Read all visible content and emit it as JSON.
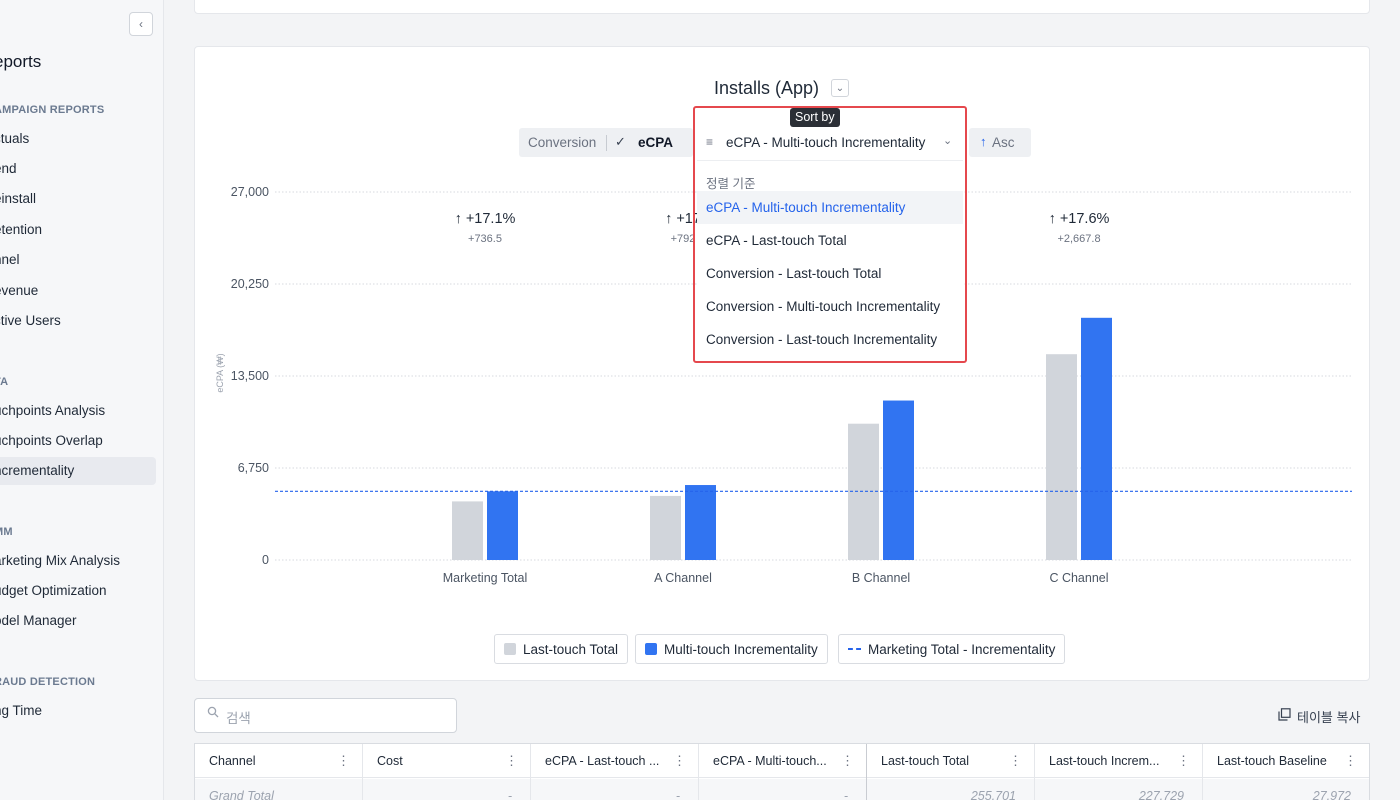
{
  "sidebar": {
    "collapse_icon": "chevron-left-icon",
    "collapse_glyph": "‹",
    "title": "eports",
    "sections": [
      {
        "label": "AMPAIGN REPORTS",
        "items": [
          "ctuals",
          "end",
          "einstall",
          "etention",
          "nnel",
          "evenue",
          "ctive Users"
        ]
      },
      {
        "label": "TA",
        "items": [
          "uchpoints Analysis",
          "uchpoints Overlap",
          "ncrementality"
        ]
      },
      {
        "label": "MM",
        "items": [
          "arketing Mix Analysis",
          "udget Optimization",
          "odel Manager"
        ]
      },
      {
        "label": "RAUD DETECTION",
        "items": [
          "ng Time"
        ]
      }
    ],
    "active_item": "ncrementality"
  },
  "chart_header": {
    "title": "Installs (App)",
    "title_caret": "⌄",
    "metric_toggle": {
      "conversion": "Conversion",
      "check": "✓",
      "ecpa": "eCPA"
    },
    "asc": {
      "arrow": "↑",
      "label": "Asc"
    }
  },
  "sort": {
    "tooltip": "Sort by",
    "lines_icon": "≡",
    "selected": "eCPA - Multi-touch Incrementality",
    "caret": "⌄",
    "header": "정렬 기준",
    "options": [
      "eCPA - Multi-touch Incrementality",
      "eCPA - Last-touch Total",
      "Conversion - Last-touch Total",
      "Conversion - Multi-touch Incrementality",
      "Conversion - Last-touch Incrementality"
    ]
  },
  "chart_data": {
    "type": "bar",
    "ylabel": "eCPA (₩)",
    "ylim": [
      0,
      27000
    ],
    "yticks": [
      "27,000",
      "20,250",
      "13,500",
      "6,750",
      "0"
    ],
    "ytick_values": [
      27000,
      20250,
      13500,
      6750,
      0
    ],
    "categories": [
      "Marketing Total",
      "A Channel",
      "B Channel",
      "C Channel"
    ],
    "series": [
      {
        "name": "Last-touch Total",
        "color": "#d1d5db",
        "values": [
          4300,
          4700,
          10000,
          15100
        ]
      },
      {
        "name": "Multi-touch Incrementality",
        "color": "#3174f1",
        "values": [
          5040,
          5500,
          11700,
          17770
        ]
      }
    ],
    "reference_line": {
      "name": "Marketing Total - Incrementality",
      "value": 5040,
      "color": "#2563eb"
    },
    "annotations": [
      {
        "category": "Marketing Total",
        "pct": "↑ +17.1%",
        "delta": "+736.5"
      },
      {
        "category": "A Channel",
        "pct": "↑ +17",
        "delta": "+792"
      },
      {
        "category": "C Channel",
        "pct": "↑ +17.6%",
        "delta": "+2,667.8"
      }
    ],
    "grid": true,
    "legend": "bottom"
  },
  "table": {
    "search_placeholder": "검색",
    "search_icon": "search-icon",
    "copy_label": "테이블 복사",
    "columns": [
      "Channel",
      "Cost",
      "eCPA - Last-touch ...",
      "eCPA - Multi-touch...",
      "Last-touch Total",
      "Last-touch Increm...",
      "Last-touch Baseline"
    ],
    "kebab": "⋮",
    "grand_total": [
      "Grand Total",
      "-",
      "-",
      "-",
      "255,701",
      "227,729",
      "27,972"
    ]
  }
}
